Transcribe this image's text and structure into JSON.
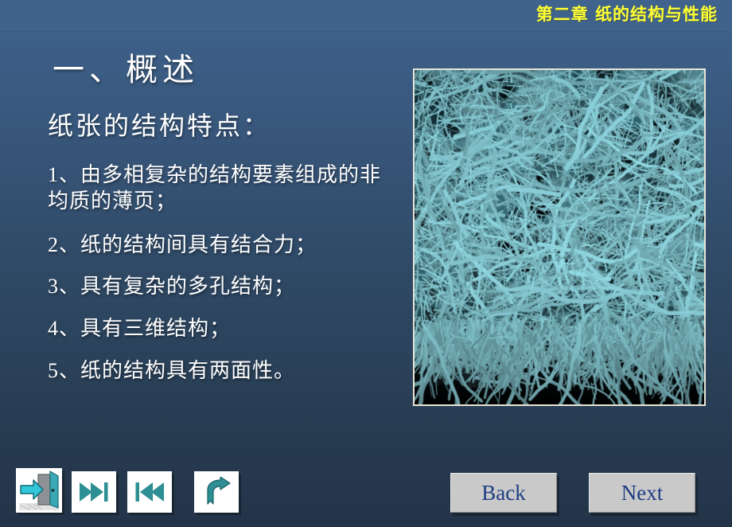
{
  "header": {
    "title": "第二章  纸的结构与性能",
    "title_color": "#ffff33",
    "bar_color": "#3f638d"
  },
  "slide": {
    "title": "一、概述",
    "subtitle": "纸张的结构特点：",
    "bullets": [
      {
        "text": "1、由多相复杂的结构要素组成的非均质的薄页；"
      },
      {
        "text": "2、纸的结构间具有结合力；"
      },
      {
        "text": "3、具有复杂的多孔结构；"
      },
      {
        "text": "4、具有三维结构；"
      },
      {
        "text": "5、纸的结构具有两面性。"
      }
    ]
  },
  "figure": {
    "name": "paper-fiber-sem-micrograph",
    "description": "扫描电镜下纸张纤维结构",
    "border_color": "#e8e4d8",
    "background_color": "#000000",
    "fiber_color": "#8fc8cf"
  },
  "nav_buttons": [
    {
      "id": "exit",
      "icon": "exit-door-icon",
      "label": "退出"
    },
    {
      "id": "last",
      "icon": "skip-forward-icon",
      "label": "末页"
    },
    {
      "id": "first",
      "icon": "skip-backward-icon",
      "label": "首页"
    },
    {
      "id": "return",
      "icon": "curved-return-arrow-icon",
      "label": "返回"
    }
  ],
  "page_buttons": {
    "back_label": "Back",
    "next_label": "Next",
    "face_color": "#c9c9c9",
    "text_color": "#1f3d82"
  },
  "theme": {
    "background_top": "#3f638d",
    "background_bottom": "#233449",
    "text_color": "#ffffff",
    "accent_teal": "#2d8f94"
  }
}
